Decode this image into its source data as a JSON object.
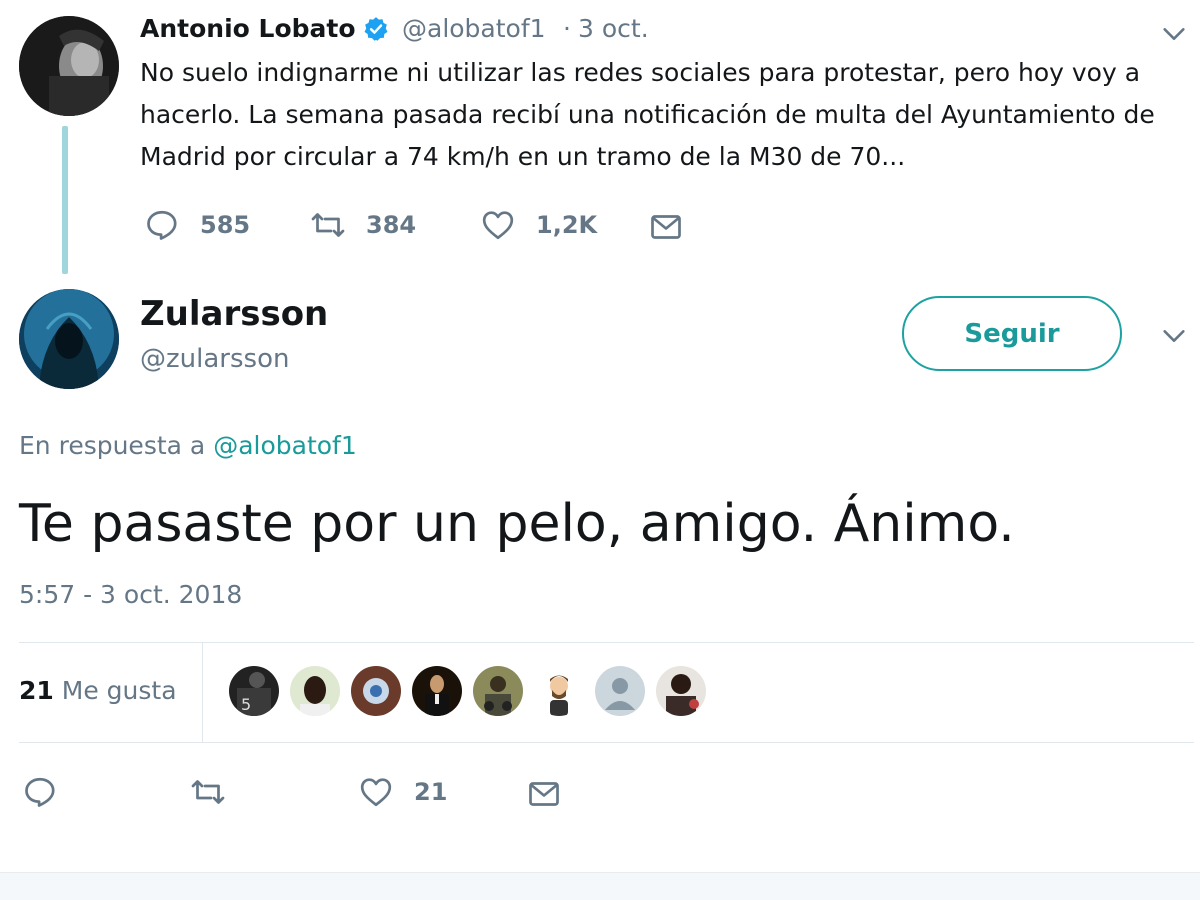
{
  "parent_tweet": {
    "author_name": "Antonio Lobato",
    "handle": "@alobatof1",
    "separator": "·",
    "date": "3 oct.",
    "text": "No suelo indignarme ni utilizar las redes sociales para protestar, pero hoy voy a hacerlo. La semana pasada recibí una notificación de multa del Ayuntamiento de Madrid por circular a 74 km/h en un tramo de la M30 de 70...",
    "verified_icon": "verified-badge-icon",
    "actions": {
      "replies": "585",
      "retweets": "384",
      "likes": "1,2K"
    }
  },
  "main_tweet": {
    "author_name": "Zularsson",
    "handle": "@zularsson",
    "follow_label": "Seguir",
    "reply_to_prefix": "En respuesta a",
    "reply_to_handle": "@alobatof1",
    "text": "Te pasaste por un pelo, amigo. Ánimo.",
    "timestamp": "5:57 - 3 oct. 2018",
    "likes_count": "21",
    "likes_label": "Me gusta",
    "actions": {
      "likes": "21"
    }
  },
  "colors": {
    "accent": "#1a9a9a",
    "muted_text": "#657786",
    "thread_line": "#9fd5dc",
    "verified": "#1da1f2",
    "divider": "#e1e8ed"
  }
}
